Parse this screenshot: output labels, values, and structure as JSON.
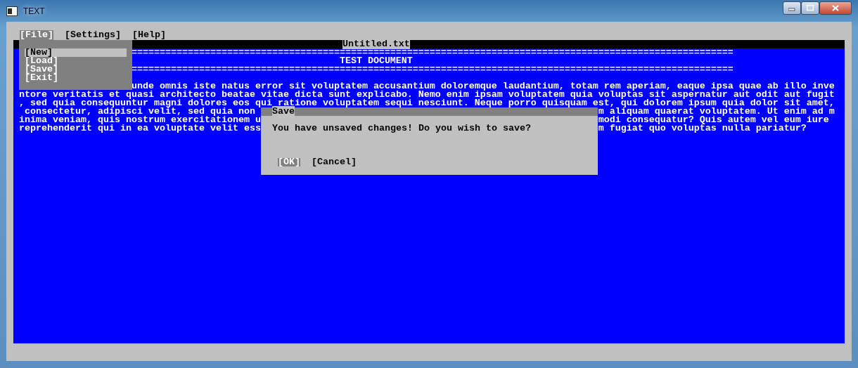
{
  "window": {
    "title": "TEXT"
  },
  "menu_bar": [
    {
      "label": "[File]",
      "selected": true
    },
    {
      "label": "[Settings]",
      "selected": false
    },
    {
      "label": "[Help]",
      "selected": false
    }
  ],
  "file_menu": {
    "items": [
      {
        "label": "[New]",
        "selected": true
      },
      {
        "label": "[Load]",
        "selected": false
      },
      {
        "label": "[Save]",
        "selected": false
      },
      {
        "label": "[Exit]",
        "selected": false
      }
    ]
  },
  "document": {
    "title": "Untitled.txt",
    "rule_top": "===========================================================================================================",
    "heading": "TEST DOCUMENT",
    "rule_bottom": "===========================================================================================================",
    "lines": [
      {
        "text": "unde omnis iste natus error sit voluptatem accusantium doloremque laudantium, totam rem aperiam, eaque ipsa quae ab illo inve",
        "covered_start": true
      },
      {
        "text": "ntore veritatis et quasi architecto beatae vitae dicta sunt explicabo. Nemo enim ipsam voluptatem quia voluptas sit aspernatur aut odit aut fugit",
        "covered_start": false
      },
      {
        "text": ", sed quia consequuntur magni dolores eos qui ratione voluptatem sequi nesciunt. Neque porro quisquam est, qui dolorem ipsum quia dolor sit amet,",
        "covered_start": false
      },
      {
        "text": " consectetur, adipisci velit, sed quia non ",
        "continued": "m aliquam quaerat voluptatem. Ut enim ad m",
        "covered_start": false
      },
      {
        "text": "inima veniam, quis nostrum exercitationem u",
        "continued": "modi consequatur? Quis autem vel eum iure",
        "covered_start": false
      },
      {
        "text": "reprehenderit qui in ea voluptate velit ess",
        "continued": "m fugiat quo voluptas nulla pariatur?",
        "covered_start": false
      }
    ]
  },
  "dialog": {
    "title": "Save",
    "message": "You have unsaved changes! Do you wish to save?",
    "buttons": [
      {
        "label": "[OK]",
        "selected": true
      },
      {
        "label": "[Cancel]",
        "selected": false
      }
    ]
  }
}
